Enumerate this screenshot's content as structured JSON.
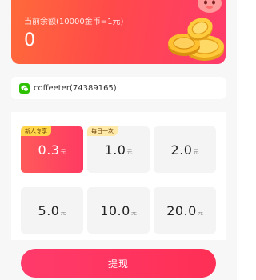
{
  "balance": {
    "label": "当前余额(10000金币=1元)",
    "value": "0"
  },
  "account": {
    "text": "coffeeter(74389165)",
    "icon": "wechat-icon"
  },
  "amounts": [
    {
      "value": "0.3",
      "unit": "元",
      "badge": "新人专享",
      "selected": true
    },
    {
      "value": "1.0",
      "unit": "元",
      "badge": "每日一次",
      "selected": false
    },
    {
      "value": "2.0",
      "unit": "元",
      "badge": "",
      "selected": false
    },
    {
      "value": "5.0",
      "unit": "元",
      "badge": "",
      "selected": false
    },
    {
      "value": "10.0",
      "unit": "元",
      "badge": "",
      "selected": false
    },
    {
      "value": "20.0",
      "unit": "元",
      "badge": "",
      "selected": false
    }
  ],
  "withdraw": {
    "label": "提现"
  },
  "colors": {
    "accent": "#ff3b6b",
    "card_gradient_start": "#ff6a3a",
    "wechat_green": "#2dc100",
    "badge_yellow": "#ffd54a"
  }
}
